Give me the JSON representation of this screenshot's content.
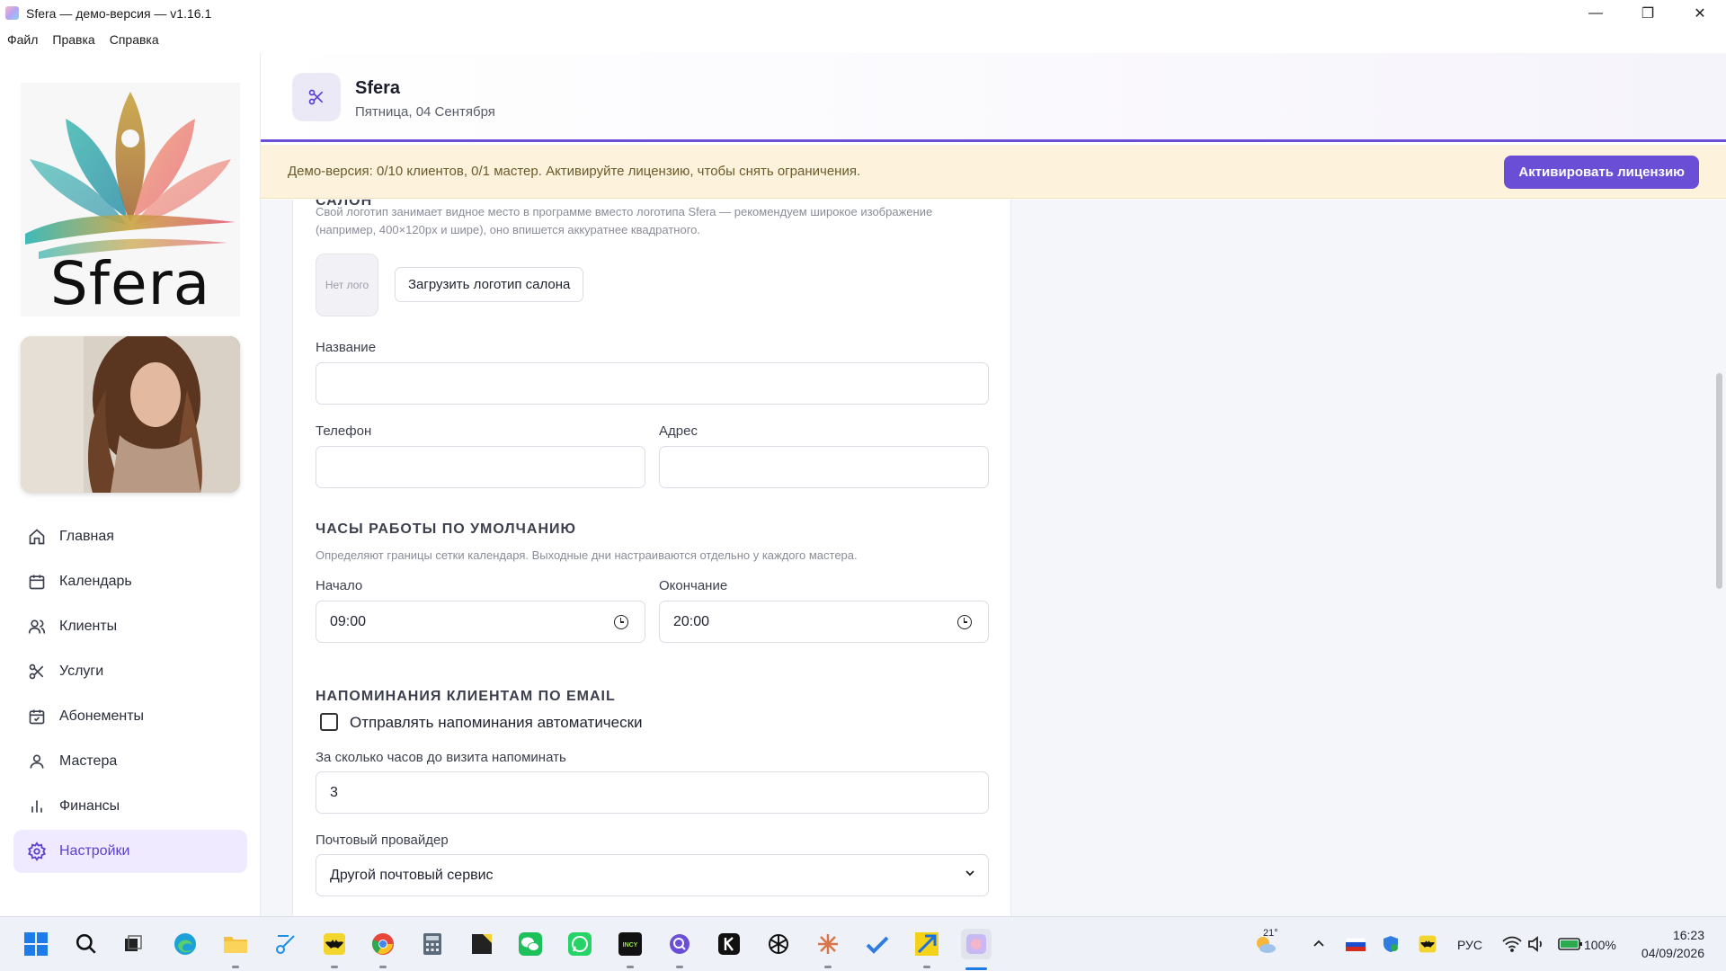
{
  "window": {
    "title": "Sfera — демо-версия — v1.16.1",
    "controls": [
      "—",
      "❐",
      "✕"
    ]
  },
  "menu": [
    "Файл",
    "Правка",
    "Справка"
  ],
  "sidebar": {
    "logo_text": "Sfera",
    "nav": [
      {
        "label": "Главная",
        "icon": "home-icon"
      },
      {
        "label": "Календарь",
        "icon": "calendar-icon"
      },
      {
        "label": "Клиенты",
        "icon": "users-icon"
      },
      {
        "label": "Услуги",
        "icon": "scissors-icon"
      },
      {
        "label": "Абонементы",
        "icon": "calendar-check-icon"
      },
      {
        "label": "Мастера",
        "icon": "user-icon"
      },
      {
        "label": "Финансы",
        "icon": "bar-chart-icon"
      },
      {
        "label": "Настройки",
        "icon": "gear-icon",
        "active": true
      }
    ]
  },
  "header": {
    "title": "Sfera",
    "date": "Пятница, 04 Сентября",
    "icon": "scissors-icon"
  },
  "banner": {
    "text": "Демо-версия: 0/10 клиентов, 0/1 мастер. Активируйте лицензию, чтобы снять ограничения.",
    "button": "Активировать лицензию"
  },
  "salon": {
    "section_title": "САЛОН",
    "description": "Свой логотип занимает видное место в программе вместо логотипа Sfera — рекомендуем широкое изображение (например, 400×120px и шире), оно впишется аккуратнее квадратного.",
    "no_logo": "Нет лого",
    "upload_button": "Загрузить логотип салона",
    "name_label": "Название",
    "name_value": "",
    "phone_label": "Телефон",
    "phone_value": "",
    "address_label": "Адрес",
    "address_value": ""
  },
  "hours": {
    "section_title": "ЧАСЫ РАБОТЫ ПО УМОЛЧАНИЮ",
    "description": "Определяют границы сетки календаря. Выходные дни настраиваются отдельно у каждого мастера.",
    "start_label": "Начало",
    "start_value": "09:00",
    "end_label": "Окончание",
    "end_value": "20:00"
  },
  "reminders": {
    "section_title": "НАПОМИНАНИЯ КЛИЕНТАМ ПО EMAIL",
    "auto_label": "Отправлять напоминания автоматически",
    "auto_checked": false,
    "hours_label": "За сколько часов до визита напоминать",
    "hours_value": "3",
    "provider_label": "Почтовый провайдер",
    "provider_value": "Другой почтовый сервис"
  },
  "taskbar": {
    "weather_temp": "21°",
    "lang": "РУС",
    "battery": "100%",
    "time": "16:23",
    "date": "04/09/2026"
  },
  "colors": {
    "accent": "#6a4fd6",
    "active_nav_bg": "#efeaff",
    "banner_bg": "#fdf3dc"
  }
}
